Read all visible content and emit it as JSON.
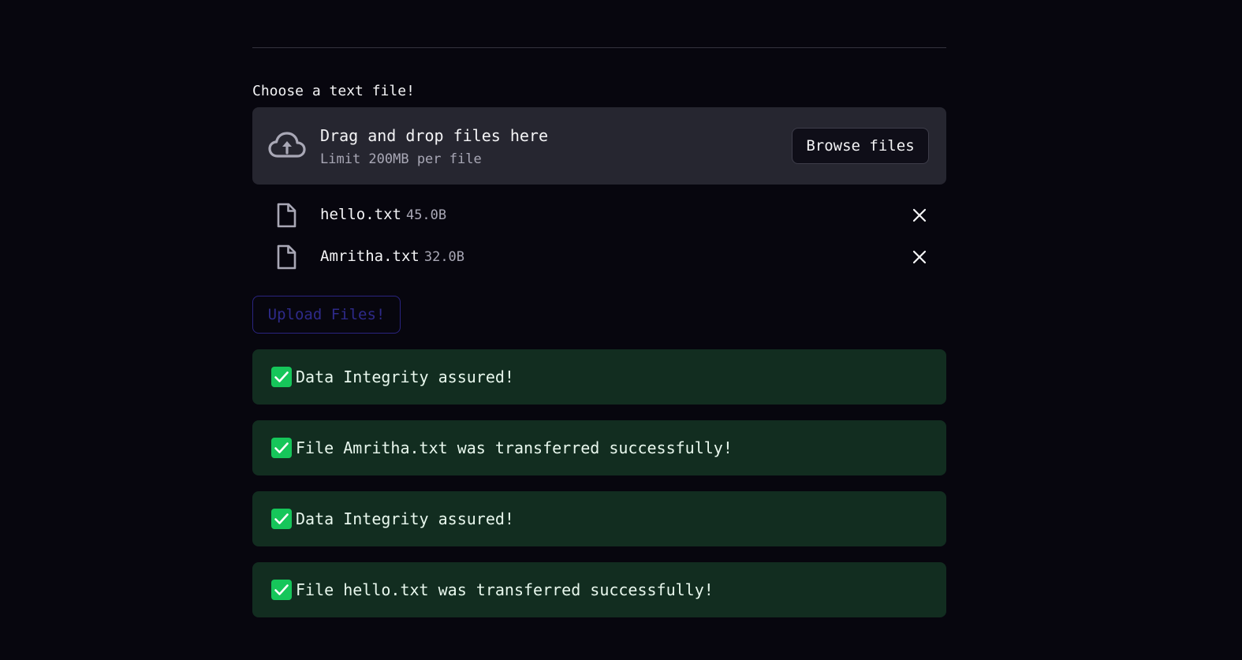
{
  "uploader": {
    "label": "Choose a text file!",
    "dropzone_title": "Drag and drop files here",
    "dropzone_limit": "Limit 200MB per file",
    "browse_label": "Browse files",
    "cloud_icon": "cloud-upload-icon"
  },
  "files": [
    {
      "name": "hello.txt",
      "size": "45.0B",
      "icon": "file-icon"
    },
    {
      "name": "Amritha.txt",
      "size": "32.0B",
      "icon": "file-icon"
    }
  ],
  "upload_button": {
    "label": "Upload Files!"
  },
  "alerts": [
    {
      "message": "Data Integrity assured!",
      "icon": "check-icon"
    },
    {
      "message": "File Amritha.txt was transferred successfully!",
      "icon": "check-icon"
    },
    {
      "message": "Data Integrity assured!",
      "icon": "check-icon"
    },
    {
      "message": "File hello.txt was transferred successfully!",
      "icon": "check-icon"
    }
  ],
  "colors": {
    "background": "#07060e",
    "dropzone": "#262630",
    "success_bg": "#122d20",
    "success_check": "#16c65a",
    "upload_disabled": "#2a2480"
  }
}
